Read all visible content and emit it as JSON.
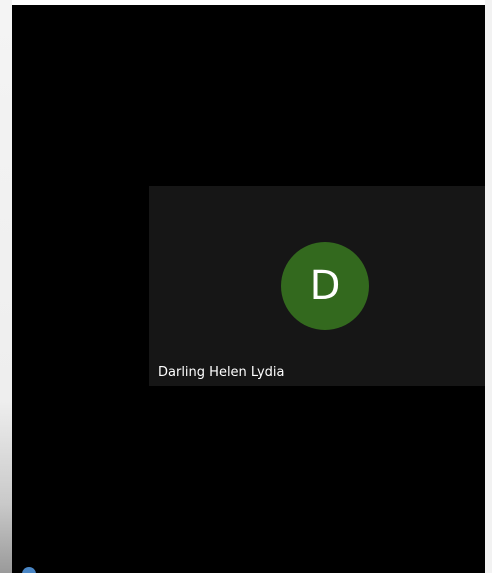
{
  "participant": {
    "initial": "D",
    "name": "Darling Helen Lydia",
    "avatar_color": "#33691e"
  },
  "colors": {
    "stage_background": "#000000",
    "tile_background": "#161616"
  }
}
